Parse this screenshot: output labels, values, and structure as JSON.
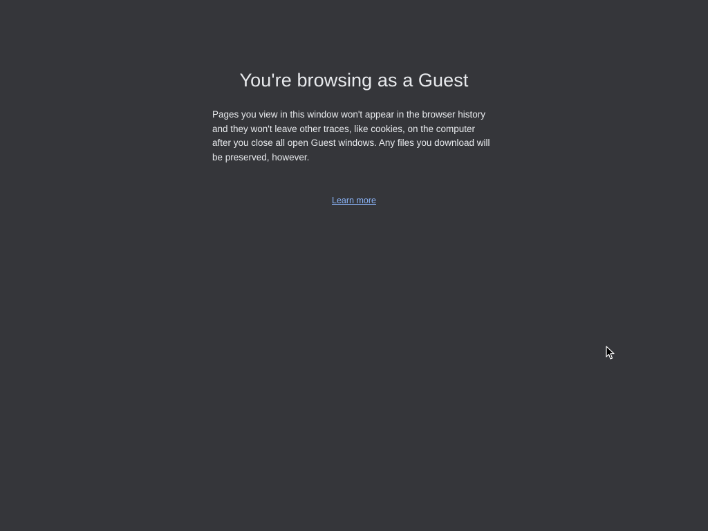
{
  "guest_page": {
    "title": "You're browsing as a Guest",
    "description": "Pages you view in this window won't appear in the browser history and they won't leave other traces, like cookies, on the computer after you close all open Guest windows. Any files you download will be preserved, however.",
    "learn_more_label": "Learn more"
  },
  "colors": {
    "background": "#35363a",
    "text": "#e8eaed",
    "link": "#8ab4f8"
  },
  "icons": {
    "cursor": "mouse-pointer-icon"
  }
}
